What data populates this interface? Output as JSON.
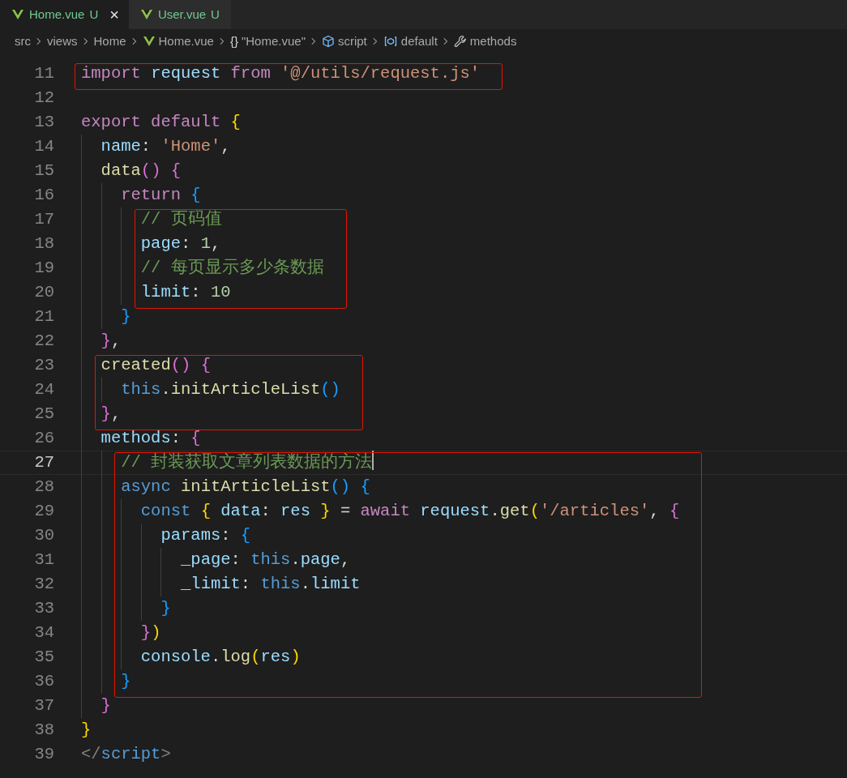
{
  "tabs": [
    {
      "label": "Home.vue",
      "badge": "U",
      "close": "×",
      "selected": true
    },
    {
      "label": "User.vue",
      "badge": "U",
      "selected": false
    }
  ],
  "breadcrumbs": [
    {
      "label": "src",
      "kind": "folder"
    },
    {
      "label": "views",
      "kind": "folder"
    },
    {
      "label": "Home",
      "kind": "folder"
    },
    {
      "label": "Home.vue",
      "kind": "file"
    },
    {
      "label": "\"Home.vue\"",
      "kind": "object",
      "symbol": "{}"
    },
    {
      "label": "script",
      "kind": "element"
    },
    {
      "label": "default",
      "kind": "module"
    },
    {
      "label": "methods",
      "kind": "method"
    }
  ],
  "blocks": [
    {
      "highlighted": true,
      "lines": [
        {
          "number": "11",
          "current": false,
          "tokens": [
            {
              "text": "import ",
              "kind": "kw"
            },
            {
              "text": "request ",
              "kind": "var"
            },
            {
              "text": "from ",
              "kind": "kw"
            },
            {
              "text": "'@/utils/request.js'",
              "kind": "str"
            }
          ]
        }
      ]
    },
    {
      "highlighted": false,
      "lines": [
        {
          "number": "12",
          "current": false
        },
        {
          "number": "13",
          "current": false,
          "tokens": [
            {
              "text": "export default ",
              "kind": "kw"
            },
            {
              "text": "{",
              "kind": "b1"
            }
          ]
        },
        {
          "number": "14",
          "current": false,
          "tokens": [
            {
              "text": "  name",
              "kind": "var"
            },
            {
              "text": ": ",
              "kind": "punc"
            },
            {
              "text": "'Home'",
              "kind": "str"
            },
            {
              "text": ",",
              "kind": "punc"
            }
          ]
        },
        {
          "number": "15",
          "current": false,
          "tokens": [
            {
              "text": "  data",
              "kind": "fn"
            },
            {
              "text": "() ",
              "kind": "b2"
            },
            {
              "text": "{",
              "kind": "b2"
            }
          ]
        },
        {
          "number": "16",
          "current": false,
          "tokens": [
            {
              "text": "    return ",
              "kind": "kw"
            },
            {
              "text": "{",
              "kind": "b3"
            }
          ]
        }
      ]
    },
    {
      "highlighted": true,
      "lines": [
        {
          "number": "17",
          "current": false,
          "tokens": [
            {
              "text": "      // 页码值",
              "kind": "cmt"
            }
          ]
        },
        {
          "number": "18",
          "current": false,
          "tokens": [
            {
              "text": "      page",
              "kind": "var"
            },
            {
              "text": ": ",
              "kind": "punc"
            },
            {
              "text": "1",
              "kind": "num"
            },
            {
              "text": ",",
              "kind": "punc"
            }
          ]
        },
        {
          "number": "19",
          "current": false,
          "tokens": [
            {
              "text": "      // 每页显示多少条数据",
              "kind": "cmt"
            }
          ]
        },
        {
          "number": "20",
          "current": false,
          "tokens": [
            {
              "text": "      limit",
              "kind": "var"
            },
            {
              "text": ": ",
              "kind": "punc"
            },
            {
              "text": "10",
              "kind": "num"
            }
          ]
        }
      ]
    },
    {
      "highlighted": false,
      "lines": [
        {
          "number": "21",
          "current": false,
          "tokens": [
            {
              "text": "    }",
              "kind": "b3"
            }
          ]
        },
        {
          "number": "22",
          "current": false,
          "tokens": [
            {
              "text": "  }",
              "kind": "b2"
            },
            {
              "text": ",",
              "kind": "punc"
            }
          ]
        }
      ]
    },
    {
      "highlighted": true,
      "lines": [
        {
          "number": "23",
          "current": false,
          "tokens": [
            {
              "text": "  created",
              "kind": "fn"
            },
            {
              "text": "() ",
              "kind": "b2"
            },
            {
              "text": "{",
              "kind": "b2"
            }
          ]
        },
        {
          "number": "24",
          "current": false,
          "tokens": [
            {
              "text": "    this",
              "kind": "storage"
            },
            {
              "text": ".",
              "kind": "punc"
            },
            {
              "text": "initArticleList",
              "kind": "fn"
            },
            {
              "text": "()",
              "kind": "b3"
            }
          ]
        },
        {
          "number": "25",
          "current": false,
          "tokens": [
            {
              "text": "  }",
              "kind": "b2"
            },
            {
              "text": ",",
              "kind": "punc"
            }
          ]
        }
      ]
    },
    {
      "highlighted": false,
      "lines": [
        {
          "number": "26",
          "current": false,
          "tokens": [
            {
              "text": "  methods",
              "kind": "var"
            },
            {
              "text": ": ",
              "kind": "punc"
            },
            {
              "text": "{",
              "kind": "b2"
            }
          ]
        }
      ]
    },
    {
      "highlighted": true,
      "lines": [
        {
          "number": "27",
          "current": true,
          "tokens": [
            {
              "text": "    // 封装获取文章列表数据的方法",
              "kind": "cmt"
            }
          ]
        },
        {
          "number": "28",
          "current": false,
          "tokens": [
            {
              "text": "    async ",
              "kind": "storage"
            },
            {
              "text": "initArticleList",
              "kind": "fn"
            },
            {
              "text": "() ",
              "kind": "b3"
            },
            {
              "text": "{",
              "kind": "b3"
            }
          ]
        },
        {
          "number": "29",
          "current": false,
          "tokens": [
            {
              "text": "      const ",
              "kind": "storage"
            },
            {
              "text": "{ ",
              "kind": "b1"
            },
            {
              "text": "data",
              "kind": "var"
            },
            {
              "text": ": ",
              "kind": "punc"
            },
            {
              "text": "res ",
              "kind": "var"
            },
            {
              "text": "}",
              "kind": "b1"
            },
            {
              "text": " = ",
              "kind": "punc"
            },
            {
              "text": "await ",
              "kind": "kw"
            },
            {
              "text": "request",
              "kind": "var"
            },
            {
              "text": ".",
              "kind": "punc"
            },
            {
              "text": "get",
              "kind": "fn"
            },
            {
              "text": "(",
              "kind": "b1"
            },
            {
              "text": "'/articles'",
              "kind": "str"
            },
            {
              "text": ", ",
              "kind": "punc"
            },
            {
              "text": "{",
              "kind": "b2"
            }
          ]
        },
        {
          "number": "30",
          "current": false,
          "tokens": [
            {
              "text": "        params",
              "kind": "var"
            },
            {
              "text": ": ",
              "kind": "punc"
            },
            {
              "text": "{",
              "kind": "b3"
            }
          ]
        },
        {
          "number": "31",
          "current": false,
          "tokens": [
            {
              "text": "          _page",
              "kind": "var"
            },
            {
              "text": ": ",
              "kind": "punc"
            },
            {
              "text": "this",
              "kind": "storage"
            },
            {
              "text": ".",
              "kind": "punc"
            },
            {
              "text": "page",
              "kind": "var"
            },
            {
              "text": ",",
              "kind": "punc"
            }
          ]
        },
        {
          "number": "32",
          "current": false,
          "tokens": [
            {
              "text": "          _limit",
              "kind": "var"
            },
            {
              "text": ": ",
              "kind": "punc"
            },
            {
              "text": "this",
              "kind": "storage"
            },
            {
              "text": ".",
              "kind": "punc"
            },
            {
              "text": "limit",
              "kind": "var"
            }
          ]
        },
        {
          "number": "33",
          "current": false,
          "tokens": [
            {
              "text": "        }",
              "kind": "b3"
            }
          ]
        },
        {
          "number": "34",
          "current": false,
          "tokens": [
            {
              "text": "      }",
              "kind": "b2"
            },
            {
              "text": ")",
              "kind": "b1"
            }
          ]
        },
        {
          "number": "35",
          "current": false,
          "tokens": [
            {
              "text": "      console",
              "kind": "var"
            },
            {
              "text": ".",
              "kind": "punc"
            },
            {
              "text": "log",
              "kind": "fn"
            },
            {
              "text": "(",
              "kind": "b1"
            },
            {
              "text": "res",
              "kind": "var"
            },
            {
              "text": ")",
              "kind": "b1"
            }
          ]
        },
        {
          "number": "36",
          "current": false,
          "tokens": [
            {
              "text": "    }",
              "kind": "b3"
            }
          ]
        }
      ]
    },
    {
      "highlighted": false,
      "lines": [
        {
          "number": "37",
          "current": false,
          "tokens": [
            {
              "text": "  }",
              "kind": "b2"
            }
          ]
        },
        {
          "number": "38",
          "current": false,
          "tokens": [
            {
              "text": "}",
              "kind": "b1"
            }
          ]
        },
        {
          "number": "39",
          "current": false,
          "tokens": [
            {
              "text": "</",
              "kind": "tag"
            },
            {
              "text": "script",
              "kind": "tagname"
            },
            {
              "text": ">",
              "kind": "tag"
            }
          ]
        }
      ]
    }
  ]
}
